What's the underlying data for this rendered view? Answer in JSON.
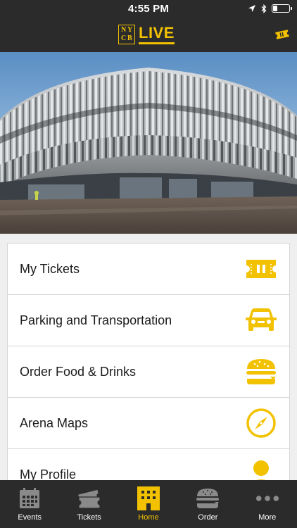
{
  "status_bar": {
    "time": "4:55 PM"
  },
  "header": {
    "logo_badge": [
      "N",
      "Y",
      "C",
      "B"
    ],
    "logo_text": "LIVE",
    "ticket_icon": "ticket-icon"
  },
  "hero": {
    "icon": "arena-photo"
  },
  "menu": {
    "items": [
      {
        "label": "My Tickets",
        "icon": "ticket-icon"
      },
      {
        "label": "Parking and Transportation",
        "icon": "car-icon"
      },
      {
        "label": "Order Food & Drinks",
        "icon": "burger-icon"
      },
      {
        "label": "Arena Maps",
        "icon": "compass-icon"
      },
      {
        "label": "My Profile",
        "icon": "profile-icon"
      }
    ]
  },
  "tabs": [
    {
      "label": "Events",
      "icon": "calendar-icon"
    },
    {
      "label": "Tickets",
      "icon": "tickets-icon"
    },
    {
      "label": "Home",
      "icon": "building-icon",
      "active": true
    },
    {
      "label": "Order",
      "icon": "burger-icon"
    },
    {
      "label": "More",
      "icon": "more-icon"
    }
  ],
  "colors": {
    "accent": "#f2c200",
    "bar": "#2b2b2b",
    "inactive_icon": "#8a8a8a"
  }
}
